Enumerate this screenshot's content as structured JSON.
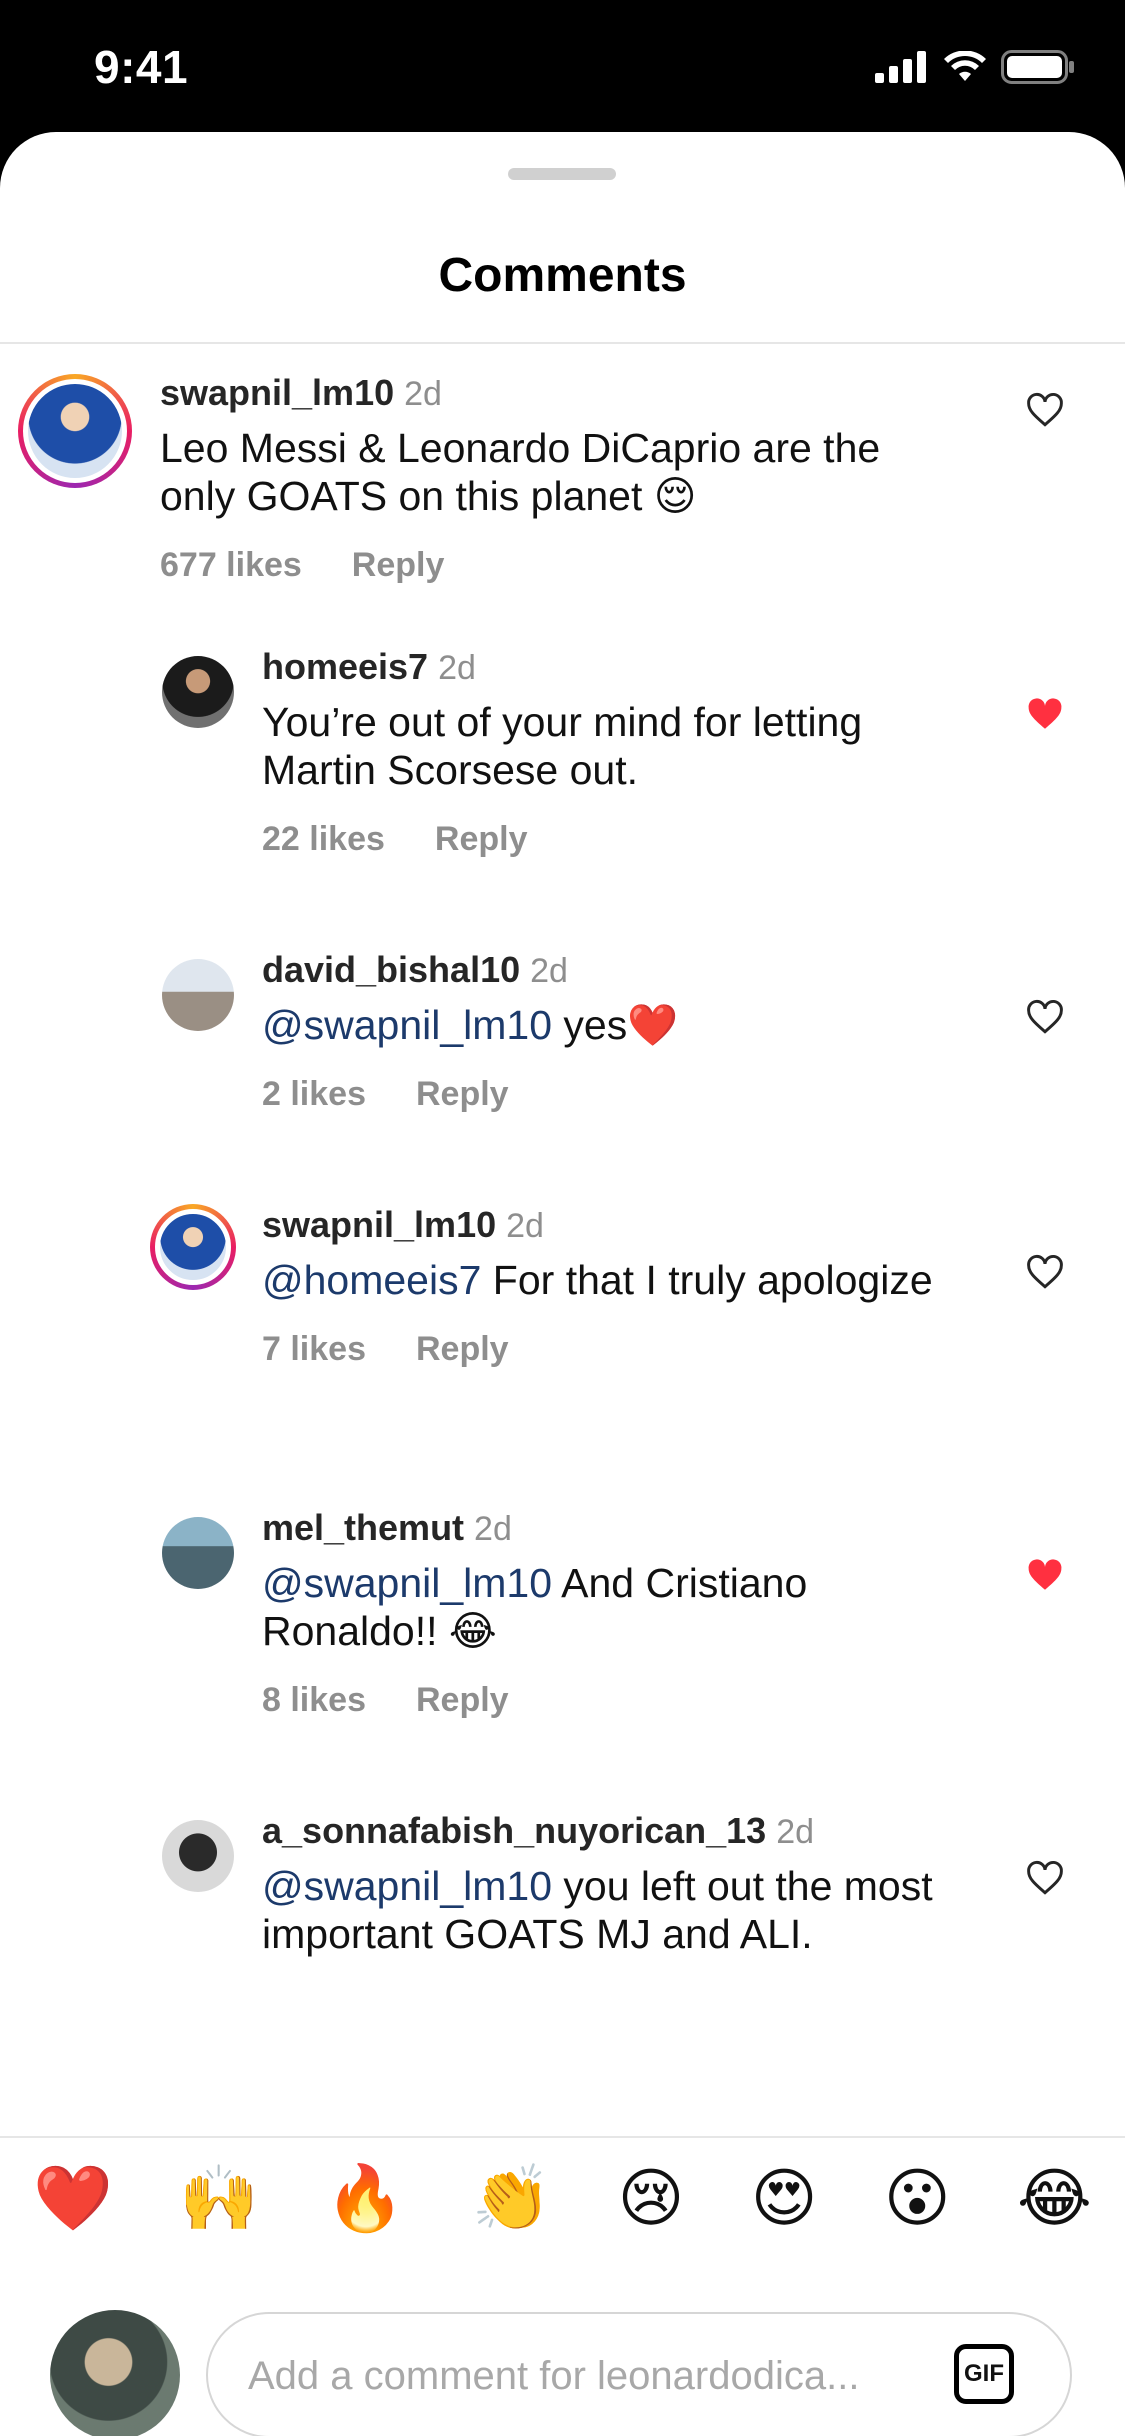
{
  "status": {
    "time": "9:41"
  },
  "header": {
    "title": "Comments"
  },
  "comments": [
    {
      "username": "swapnil_lm10",
      "time": "2d",
      "text_pre": "",
      "mention": "",
      "text": "Leo Messi & Leonardo DiCaprio are the only GOATS on this planet 😌",
      "likes": "677 likes",
      "reply": "Reply",
      "liked": false
    },
    {
      "username": "homeeis7",
      "time": "2d",
      "mention": "",
      "text": "You’re out of your mind for letting Martin Scorsese out.",
      "likes": "22 likes",
      "reply": "Reply",
      "liked": true
    },
    {
      "username": "david_bishal10",
      "time": "2d",
      "mention": "@swapnil_lm10",
      "text": " yes❤️",
      "likes": "2 likes",
      "reply": "Reply",
      "liked": false
    },
    {
      "username": "swapnil_lm10",
      "time": "2d",
      "mention": "@homeeis7",
      "text": " For that I truly apologize",
      "likes": "7 likes",
      "reply": "Reply",
      "liked": false
    },
    {
      "username": "mel_themut",
      "time": "2d",
      "mention": "@swapnil_lm10",
      "text": " And Cristiano Ronaldo!! 😂",
      "likes": "8 likes",
      "reply": "Reply",
      "liked": true
    },
    {
      "username": "a_sonnafabish_nuyorican_13",
      "time": "2d",
      "mention": "@swapnil_lm10",
      "text": " you left out the most important GOATS MJ and ALI.",
      "likes": "",
      "reply": "",
      "liked": false
    }
  ],
  "reactions": [
    "❤️",
    "🙌",
    "🔥",
    "👏",
    "😢",
    "😍",
    "😮",
    "😂"
  ],
  "composer": {
    "placeholder": "Add a comment for leonardodica...",
    "gif": "GIF"
  },
  "colors": {
    "like_red": "#ff3040",
    "mention_blue": "#1c3a6b"
  }
}
